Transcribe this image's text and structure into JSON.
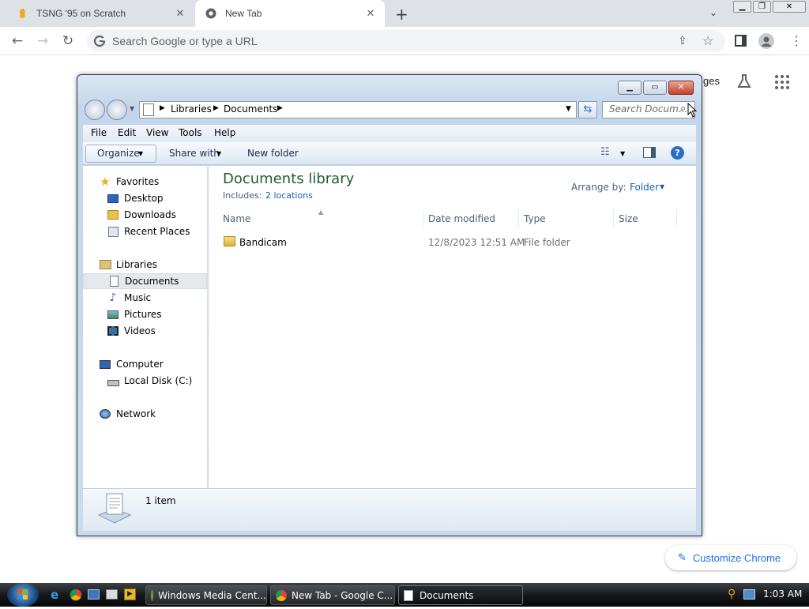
{
  "chrome": {
    "tabs": [
      {
        "title": "TSNG '95 on Scratch",
        "icon": "scratch-icon"
      },
      {
        "title": "New Tab",
        "icon": "chrome-icon"
      }
    ],
    "new_tab_symbol": "+",
    "omnibox_placeholder": "Search Google or type a URL",
    "ntp_images_partial": "ges",
    "customize_label": "Customize Chrome"
  },
  "explorer": {
    "breadcrumb": [
      "Libraries",
      "Documents"
    ],
    "search_placeholder": "Search Docum...",
    "menu": [
      "File",
      "Edit",
      "View",
      "Tools",
      "Help"
    ],
    "commands": {
      "organize": "Organize",
      "share": "Share with",
      "new_folder": "New folder"
    },
    "nav": {
      "favorites": "Favorites",
      "favorites_items": [
        "Desktop",
        "Downloads",
        "Recent Places"
      ],
      "libraries": "Libraries",
      "libraries_items": [
        "Documents",
        "Music",
        "Pictures",
        "Videos"
      ],
      "computer": "Computer",
      "computer_items": [
        "Local Disk (C:)"
      ],
      "network": "Network"
    },
    "library_title": "Documents library",
    "includes_label": "Includes:",
    "includes_link": "2 locations",
    "arrange_label": "Arrange by:",
    "arrange_value": "Folder",
    "columns": [
      "Name",
      "Date modified",
      "Type",
      "Size"
    ],
    "files": [
      {
        "name": "Bandicam",
        "date": "12/8/2023 12:51 AM",
        "type": "File folder",
        "size": ""
      }
    ],
    "status": "1 item"
  },
  "taskbar": {
    "tasks": [
      "Windows Media Cent...",
      "New Tab - Google C...",
      "Documents"
    ],
    "clock": "1:03 AM"
  },
  "colors": {
    "library_title": "#1e5f2e",
    "link": "#1a5fb4",
    "chrome_accent": "#1a73e8"
  }
}
